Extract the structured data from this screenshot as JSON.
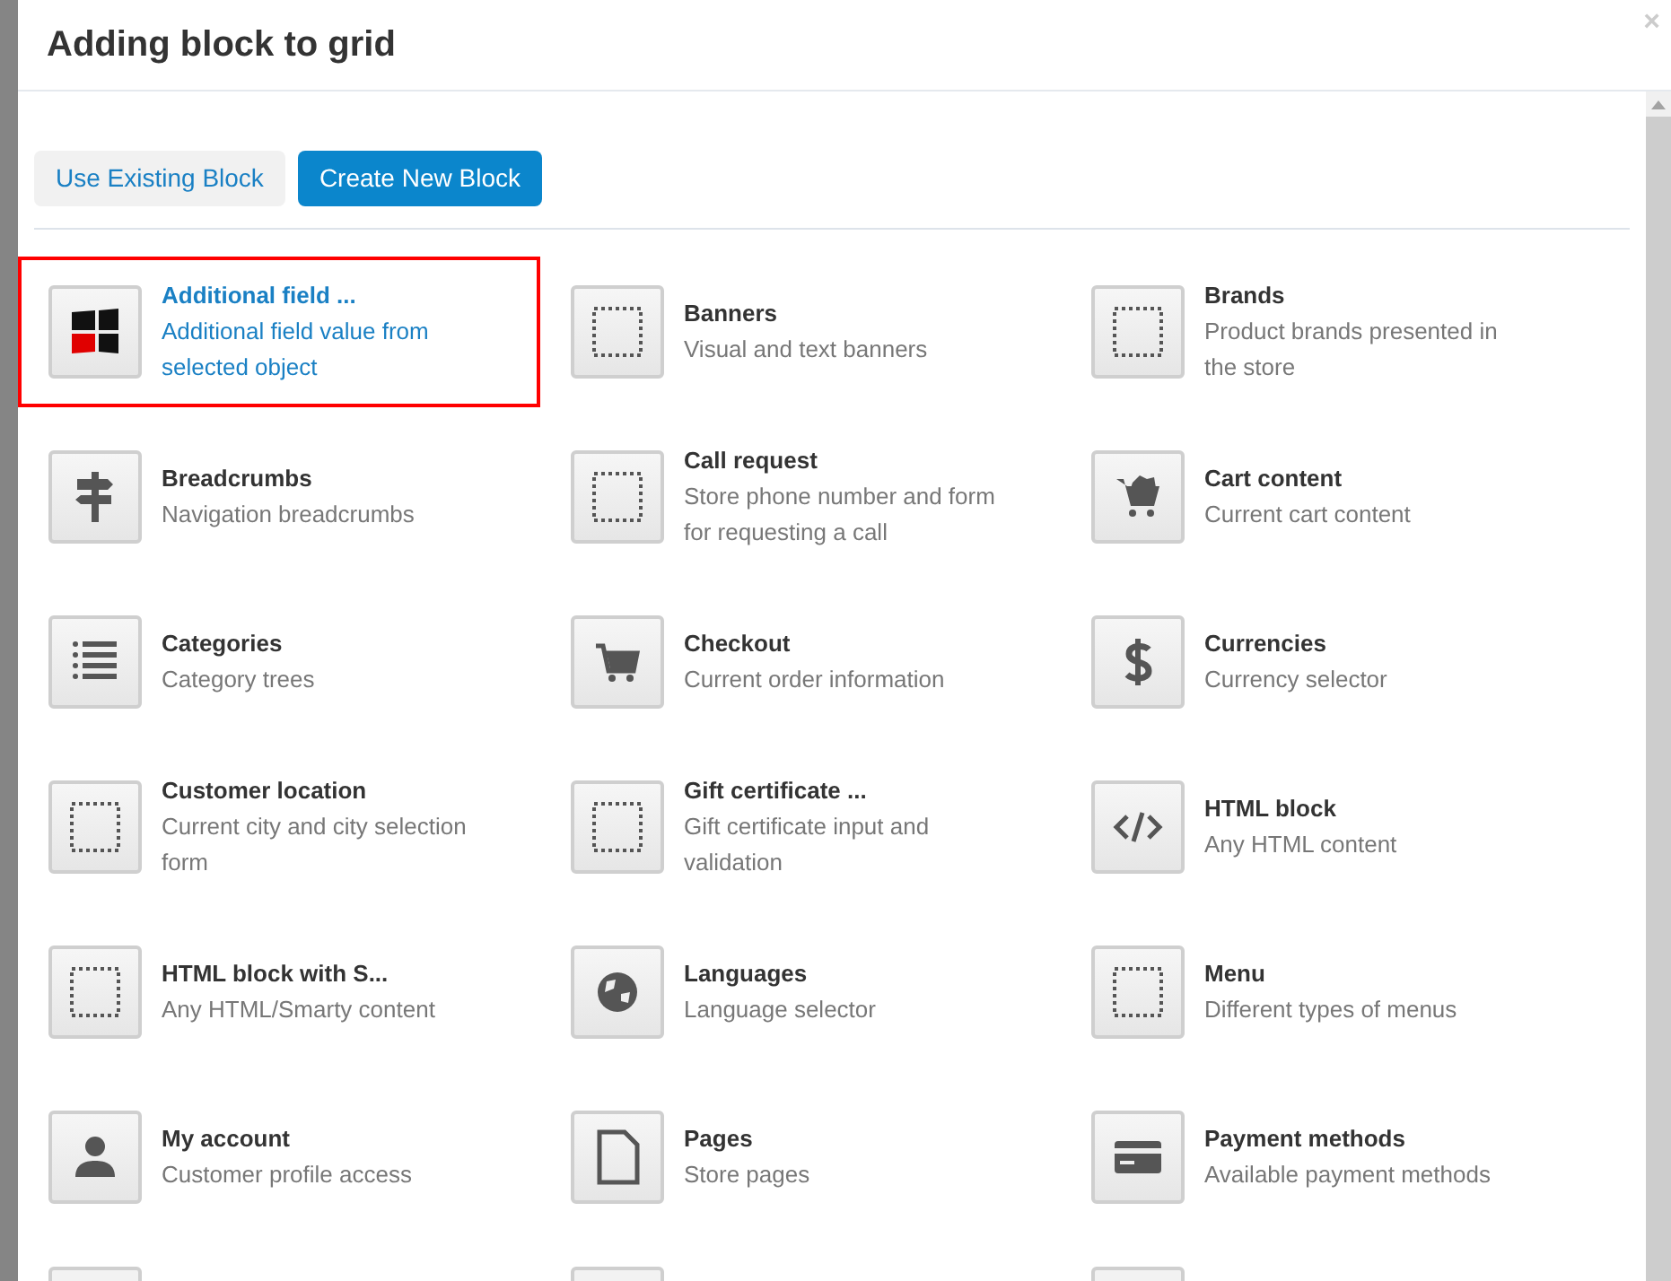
{
  "dialog": {
    "title": "Adding block to grid",
    "close": "×"
  },
  "tabs": [
    {
      "label": "Use Existing Block",
      "selected": false
    },
    {
      "label": "Create New Block",
      "selected": true
    }
  ],
  "blocks": [
    {
      "title": "Additional field ...",
      "description": "Additional field value from selected object",
      "selected": true
    },
    {
      "title": "Banners",
      "description": "Visual and text banners",
      "selected": false
    },
    {
      "title": "Brands",
      "description": "Product brands presented in the store",
      "selected": false
    },
    {
      "title": "Breadcrumbs",
      "description": "Navigation breadcrumbs",
      "selected": false
    },
    {
      "title": "Call request",
      "description": "Store phone number and form for requesting a call",
      "selected": false
    },
    {
      "title": "Cart content",
      "description": "Current cart content",
      "selected": false
    },
    {
      "title": "Categories",
      "description": "Category trees",
      "selected": false
    },
    {
      "title": "Checkout",
      "description": "Current order information",
      "selected": false
    },
    {
      "title": "Currencies",
      "description": "Currency selector",
      "selected": false
    },
    {
      "title": "Customer location",
      "description": "Current city and city selection form",
      "selected": false
    },
    {
      "title": "Gift certificate ...",
      "description": "Gift certificate input and validation",
      "selected": false
    },
    {
      "title": "HTML block",
      "description": "Any HTML content",
      "selected": false
    },
    {
      "title": "HTML block with S...",
      "description": "Any HTML/Smarty content",
      "selected": false
    },
    {
      "title": "Languages",
      "description": "Language selector",
      "selected": false
    },
    {
      "title": "Menu",
      "description": "Different types of menus",
      "selected": false
    },
    {
      "title": "My account",
      "description": "Customer profile access",
      "selected": false
    },
    {
      "title": "Pages",
      "description": "Store pages",
      "selected": false
    },
    {
      "title": "Payment methods",
      "description": "Available payment methods",
      "selected": false
    }
  ]
}
